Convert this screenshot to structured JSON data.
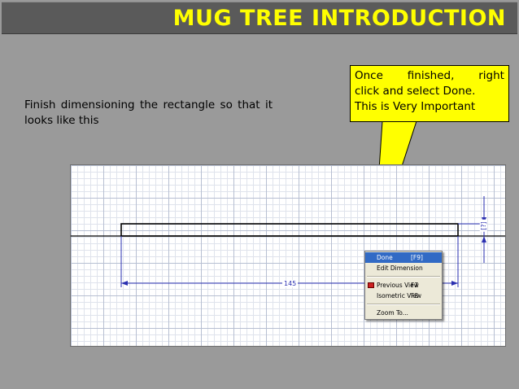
{
  "title": "MUG TREE INTRODUCTION",
  "instruction": "Finish dimensioning the rectangle so that it looks like this",
  "callout": {
    "line1_words": [
      "Once",
      "finished,",
      "right"
    ],
    "line2": "click and select Done.",
    "line3": "This is Very Important"
  },
  "dimensions": {
    "bottom_value": "145",
    "right_value": "[?]"
  },
  "context_menu": {
    "items": [
      {
        "label": "Done",
        "shortcut": "[F9]",
        "selected": true
      },
      {
        "label": "Edit Dimension",
        "shortcut": ""
      },
      {
        "label": "Previous View",
        "shortcut": "F7"
      },
      {
        "label": "Isometric View",
        "shortcut": "F8"
      },
      {
        "label": "Zoom To...",
        "shortcut": ""
      }
    ]
  },
  "colors": {
    "title_bar": "#5a5a5a",
    "title_text": "#ffff00",
    "callout_bg": "#ffff00",
    "dimension_line": "#2a2fb0",
    "menu_highlight": "#316ac5"
  }
}
